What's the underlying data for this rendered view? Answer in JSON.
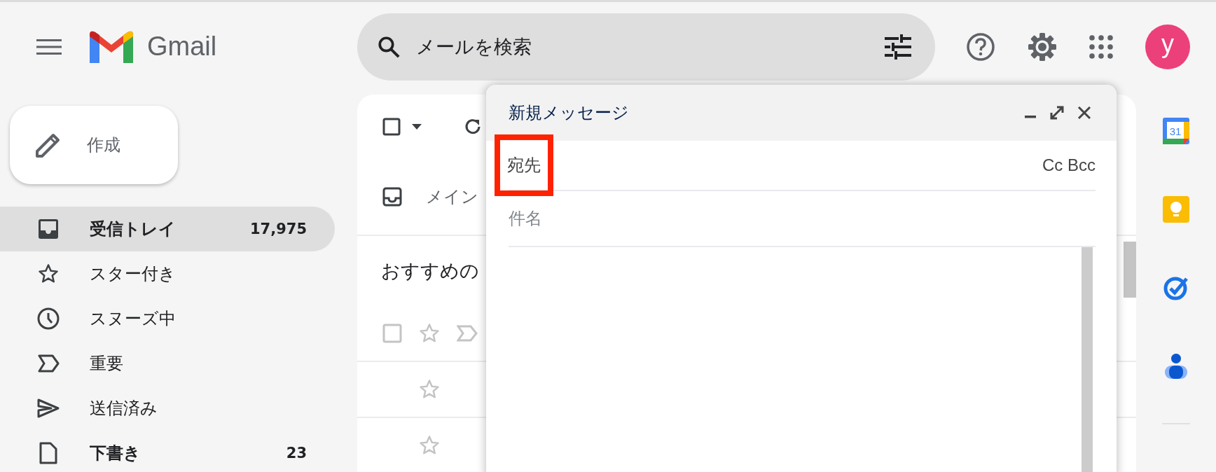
{
  "header": {
    "app_name": "Gmail",
    "search": {
      "placeholder": "メールを検索"
    },
    "avatar": {
      "letter": "y",
      "color": "#ec407a"
    }
  },
  "compose_button": {
    "label": "作成"
  },
  "nav": [
    {
      "kind": "inbox",
      "label": "受信トレイ",
      "count": "17,975",
      "selected": true,
      "unread": true
    },
    {
      "kind": "star",
      "label": "スター付き",
      "selected": false,
      "unread": false
    },
    {
      "kind": "clock",
      "label": "スヌーズ中",
      "selected": false,
      "unread": false
    },
    {
      "kind": "important",
      "label": "重要",
      "selected": false,
      "unread": false
    },
    {
      "kind": "send",
      "label": "送信済み",
      "selected": false,
      "unread": false
    },
    {
      "kind": "draft",
      "label": "下書き",
      "count": "23",
      "selected": false,
      "unread": true
    }
  ],
  "mail_list": {
    "select_all_checked": false,
    "tab": {
      "label": "メイン"
    },
    "section_title": "おすすめの",
    "rows": [
      {
        "kind": "header",
        "checked": false,
        "starred": false
      },
      {
        "kind": "mail",
        "starred": false
      },
      {
        "kind": "mail",
        "starred": false
      }
    ]
  },
  "compose": {
    "title": "新規メッセージ",
    "to": {
      "label": "宛先",
      "highlighted": true
    },
    "cc": "Cc",
    "bcc": "Bcc",
    "subject": {
      "placeholder": "件名"
    }
  },
  "side_apps": [
    {
      "kind": "calendar",
      "day": "31"
    },
    {
      "kind": "keep"
    },
    {
      "kind": "tasks"
    },
    {
      "kind": "contacts"
    }
  ]
}
